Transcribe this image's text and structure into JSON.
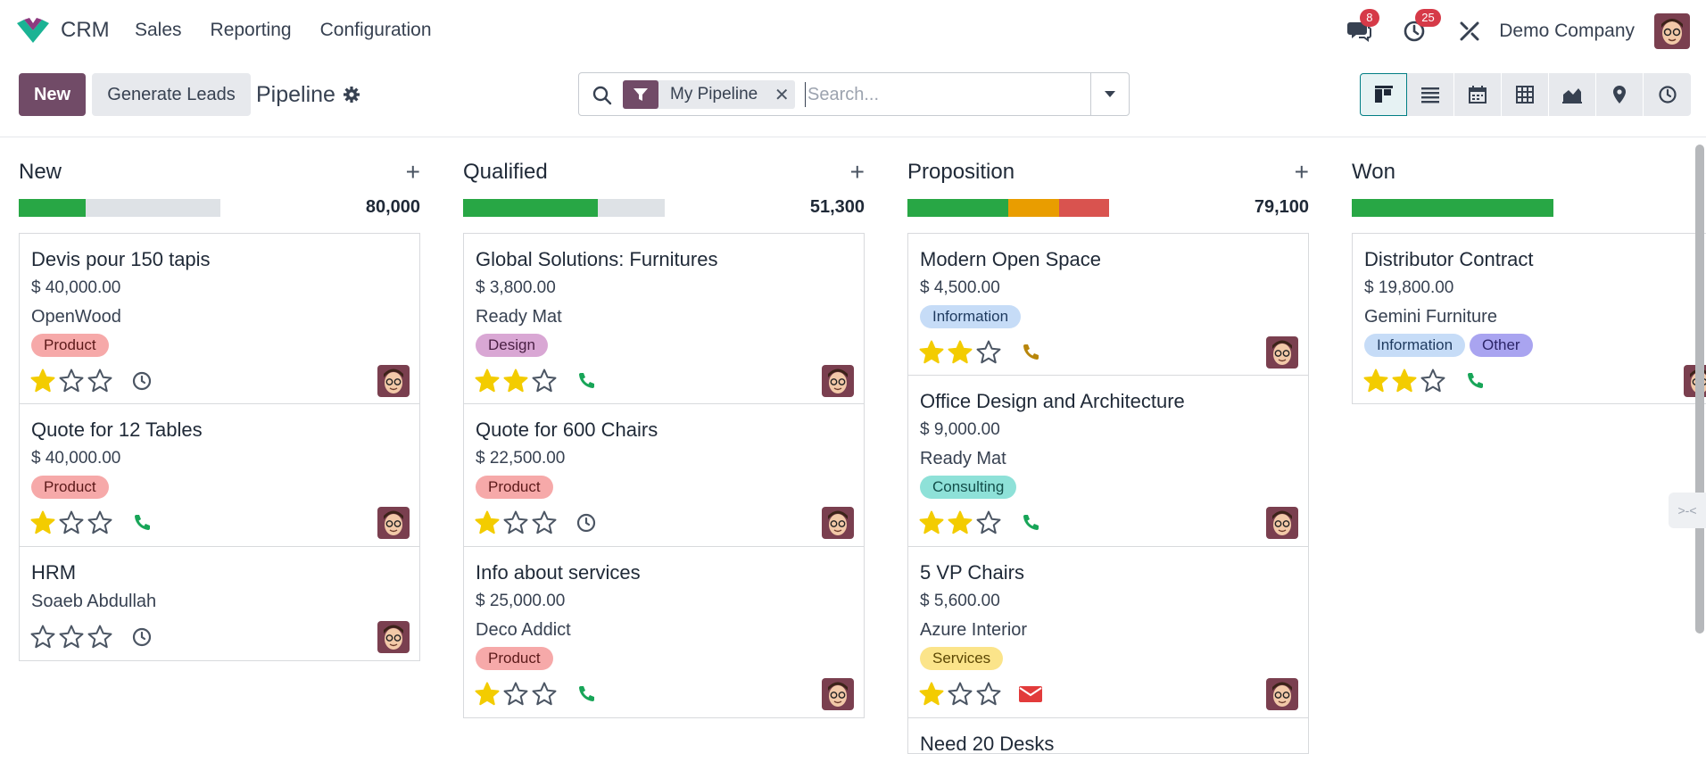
{
  "topnav": {
    "app_name": "CRM",
    "menu": [
      "Sales",
      "Reporting",
      "Configuration"
    ],
    "messages_badge": "8",
    "activities_badge": "25",
    "company": "Demo Company"
  },
  "control": {
    "new_label": "New",
    "generate_label": "Generate Leads",
    "title": "Pipeline",
    "facet_label": "My Pipeline",
    "search_placeholder": "Search..."
  },
  "colors": {
    "primary": "#714b67",
    "green": "#28a745",
    "orange": "#e99d00",
    "red": "#d9534f",
    "teal": "#017e84"
  },
  "columns": [
    {
      "title": "New",
      "total": "80,000",
      "progress": [
        {
          "color": "green",
          "fraction": 0.33
        }
      ],
      "cards": [
        {
          "title": "Devis pour 150 tapis",
          "amount": "$ 40,000.00",
          "company": "OpenWood",
          "tags": [
            {
              "label": "Product",
              "kind": "product"
            }
          ],
          "stars": 1,
          "activity": "clock-icon"
        },
        {
          "title": "Quote for 12 Tables",
          "amount": "$ 40,000.00",
          "company": "",
          "tags": [
            {
              "label": "Product",
              "kind": "product"
            }
          ],
          "stars": 1,
          "activity": "phone-icon"
        },
        {
          "title": "HRM",
          "amount": "",
          "company": "Soaeb Abdullah",
          "tags": [],
          "stars": 0,
          "activity": "clock-icon"
        }
      ]
    },
    {
      "title": "Qualified",
      "total": "51,300",
      "progress": [
        {
          "color": "green",
          "fraction": 0.67
        }
      ],
      "cards": [
        {
          "title": "Global Solutions: Furnitures",
          "amount": "$ 3,800.00",
          "company": "Ready Mat",
          "tags": [
            {
              "label": "Design",
              "kind": "design"
            }
          ],
          "stars": 2,
          "activity": "phone-icon"
        },
        {
          "title": "Quote for 600 Chairs",
          "amount": "$ 22,500.00",
          "company": "",
          "tags": [
            {
              "label": "Product",
              "kind": "product"
            }
          ],
          "stars": 1,
          "activity": "clock-icon"
        },
        {
          "title": "Info about services",
          "amount": "$ 25,000.00",
          "company": "Deco Addict",
          "tags": [
            {
              "label": "Product",
              "kind": "product"
            }
          ],
          "stars": 1,
          "activity": "phone-icon"
        }
      ]
    },
    {
      "title": "Proposition",
      "total": "79,100",
      "progress": [
        {
          "color": "green",
          "fraction": 0.5
        },
        {
          "color": "orange",
          "fraction": 0.25
        },
        {
          "color": "red",
          "fraction": 0.25
        }
      ],
      "cards": [
        {
          "title": "Modern Open Space",
          "amount": "$ 4,500.00",
          "company": "",
          "tags": [
            {
              "label": "Information",
              "kind": "information"
            }
          ],
          "stars": 2,
          "activity": "phone-icon-warning"
        },
        {
          "title": "Office Design and Architecture",
          "amount": "$ 9,000.00",
          "company": "Ready Mat",
          "tags": [
            {
              "label": "Consulting",
              "kind": "consulting"
            }
          ],
          "stars": 2,
          "activity": "phone-icon"
        },
        {
          "title": "5 VP Chairs",
          "amount": "$ 5,600.00",
          "company": "Azure Interior",
          "tags": [
            {
              "label": "Services",
              "kind": "services"
            }
          ],
          "stars": 1,
          "activity": "envelope-icon"
        },
        {
          "title": "Need 20 Desks",
          "amount": "",
          "company": "",
          "tags": [],
          "stars": 0,
          "activity": ""
        }
      ]
    },
    {
      "title": "Won",
      "total": "",
      "progress": [
        {
          "color": "green",
          "fraction": 1.0
        }
      ],
      "cards": [
        {
          "title": "Distributor Contract",
          "amount": "$ 19,800.00",
          "company": "Gemini Furniture",
          "tags": [
            {
              "label": "Information",
              "kind": "information"
            },
            {
              "label": "Other",
              "kind": "other"
            }
          ],
          "stars": 2,
          "activity": "phone-icon"
        }
      ]
    }
  ]
}
